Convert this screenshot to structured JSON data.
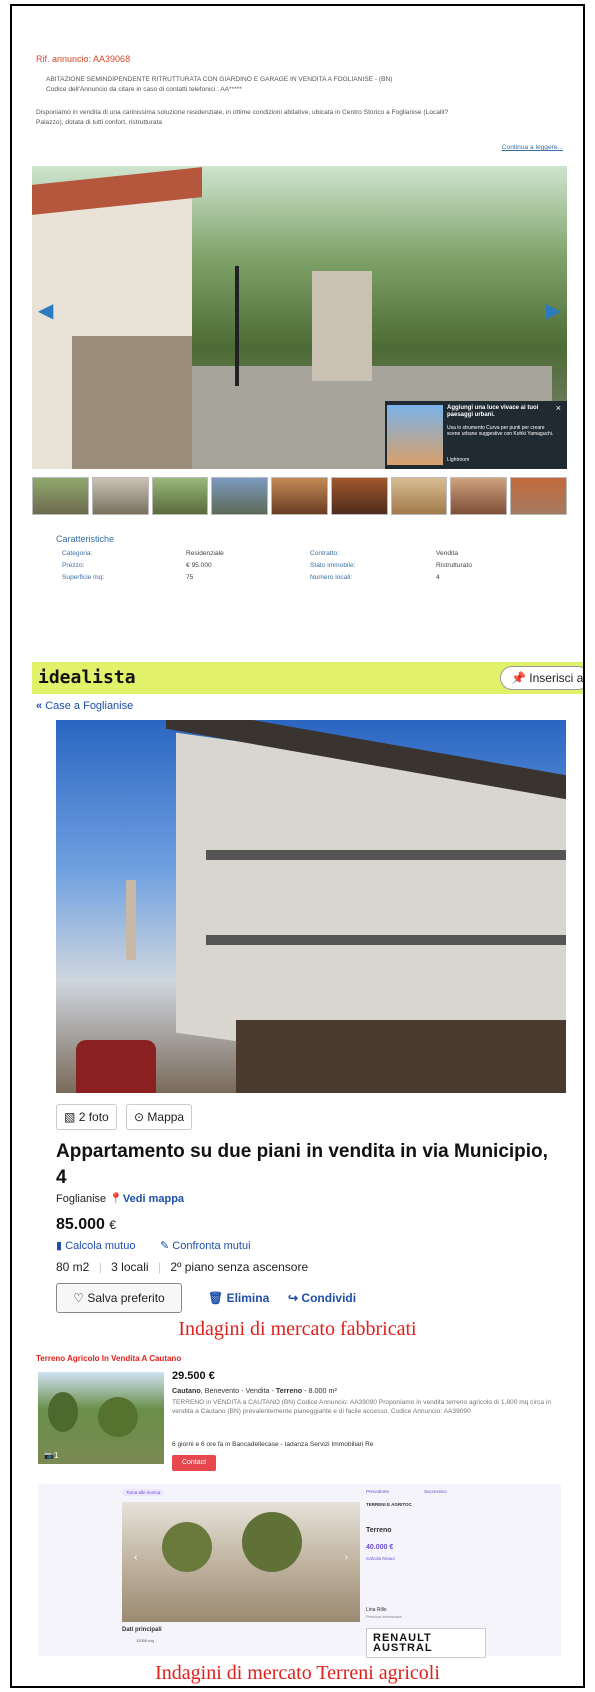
{
  "section1": {
    "rif": "Rif. annuncio: AA39068",
    "headline": "ABITAZIONE SEMINDIPENDENTE RITRUTTURATA CON GIARDINO E GARAGE IN VENDITA A FOGLIANISE - (BN)",
    "code_line": "Codice dell'Annuncio da citare in caso di contatti telefonici : AA*****",
    "desc1": "Disponiamo in vendita di una carinissima soluzione residenziale, in ottime condizioni abitative, ubicata in Centro Storico a Foglianise (Localit?",
    "desc2": "Palazzo), dotata di tutti confort, ristrutturata",
    "continue_link": "Continua a leggere...",
    "popup": {
      "title": "Aggiungi una luce vivace ai tuoi paesaggi urbani.",
      "body": "Usa lo strumento Curva per punti per creare scene urbane suggestive con Kohki Yamaguchi.",
      "brand": "Lightroom",
      "close": "×"
    },
    "caratteristiche": {
      "title": "Caratteristiche",
      "rows": [
        {
          "l1": "Categoria:",
          "v1": "Residenziale",
          "l2": "Contratto:",
          "v2": "Vendita"
        },
        {
          "l1": "Prezzo:",
          "v1": "€ 95.000",
          "l2": "Stato immobile:",
          "v2": "Ristrutturato"
        },
        {
          "l1": "Superficie mq:",
          "v1": "75",
          "l2": "Numero locali:",
          "v2": "4"
        }
      ]
    }
  },
  "section2": {
    "logo": "idealista",
    "insert_button": "Inserisci a",
    "back_link": "Case a Foglianise",
    "photos_chip": "2 foto",
    "map_chip": "Mappa",
    "title": "Appartamento su due piani in vendita in via Municipio, 4",
    "location": "Foglianise",
    "see_map": "Vedi mappa",
    "price": "85.000",
    "currency": "€",
    "calc_mutuo": "Calcola mutuo",
    "confronta": "Confronta mutui",
    "features": [
      "80 m2",
      "3 locali",
      "2º piano senza ascensore"
    ],
    "save_button": "Salva preferito",
    "delete_button": "Elimina",
    "share_button": "Condividi",
    "caption": "Indagini di mercato fabbricati"
  },
  "section3": {
    "label": "Terreno Agricolo In Vendita A Cautano",
    "price": "29.500 €",
    "line1_bold": "Cautano",
    "line1_rest": ", Benevento - Vendita - ",
    "line1_bold2": "Terreno",
    "line1_end": " - 8.000 m²",
    "desc": "TERRENO in VENDITA a CAUTANO (BN) Codice Annuncio: AA39090 Proponiamo in vendita terreno agricolo di 1.800 mq circa in vendita a Cautano (BN) prevalentemente pianeggiante e di facile accesso. Codice Annuncio: AA39090",
    "agency": "6 giorni e 6 ore fa in Bancadellecase - Iadanza Servizi Immobiliari Re",
    "photo_count": "1",
    "contact_button": "Contact",
    "sub": {
      "back": "Torna alle ricerca",
      "prev": "Precedente",
      "next": "Successivo",
      "type_tag": "TERRENI E AGRITOC",
      "title": "Terreno",
      "price": "40.000 €",
      "calc": "Calcola Mutuo",
      "main_data": "Dati principali",
      "area": "12000 mq",
      "agent": "Lina Rillo",
      "agent_sub": "Persona interessata"
    },
    "ad": [
      "RENAULT",
      "AUSTRAL"
    ],
    "caption": "Indagini di mercato Terreni agricoli"
  }
}
